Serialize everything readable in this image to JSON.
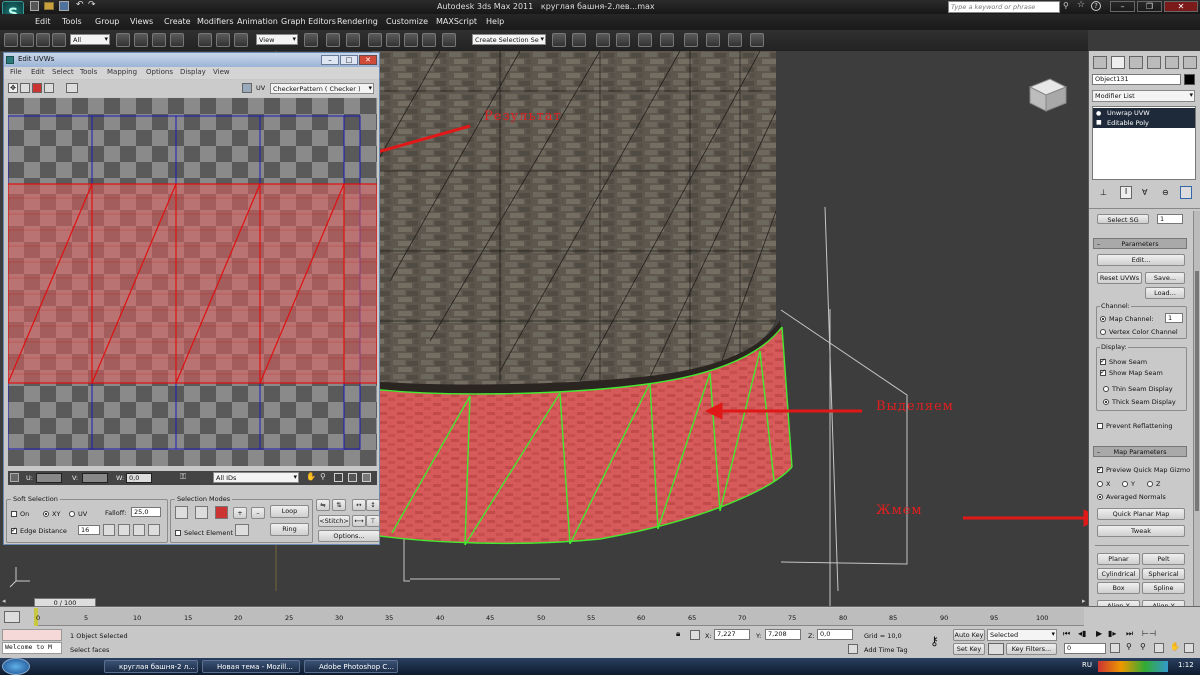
{
  "app": {
    "title": "Autodesk 3ds Max 2011",
    "file": "круглая башня-2.лев...max",
    "search_placeholder": "Type a keyword or phrase"
  },
  "menu": [
    "Edit",
    "Tools",
    "Group",
    "Views",
    "Create",
    "Modifiers",
    "Animation",
    "Graph Editors",
    "Rendering",
    "Customize",
    "MAXScript",
    "Help"
  ],
  "toolbar": {
    "selection_filter": "All",
    "ref_coord": "View",
    "named_selection": "Create Selection Se"
  },
  "uvw": {
    "title": "Edit UVWs",
    "menu": [
      "File",
      "Edit",
      "Select",
      "Tools",
      "Mapping",
      "Options",
      "Display",
      "View"
    ],
    "uv_label": "UV",
    "texture": "CheckerPattern  ( Checker )",
    "u_label": "U:",
    "v_label": "V:",
    "w_label": "W:",
    "w_value": "0,0",
    "ids": "All IDs",
    "soft_selection": "Soft Selection",
    "on_label": "On",
    "xy_label": "XY",
    "uv_axis_label": "UV",
    "falloff_label": "Falloff:",
    "falloff_value": "25,0",
    "edge_distance_label": "Edge Distance",
    "edge_distance_value": "16",
    "selection_modes": "Selection Modes",
    "select_element": "Select Element",
    "loop": "Loop",
    "ring": "Ring",
    "stitch": "Stitch",
    "options": "Options..."
  },
  "annotations": {
    "result": "Результат",
    "select": "Выделяем",
    "press": "Жмем"
  },
  "command_panel": {
    "object_name": "Object131",
    "modifier_list": "Modifier List",
    "stack": [
      "Unwrap UVW",
      "Editable Poly"
    ],
    "select_sg": "Select SG",
    "select_sg_value": "1",
    "parameters": "Parameters",
    "edit": "Edit...",
    "reset_uvws": "Reset UVWs",
    "save": "Save...",
    "load": "Load...",
    "channel": "Channel:",
    "map_channel": "Map Channel:",
    "map_channel_value": "1",
    "vertex_color_channel": "Vertex Color Channel",
    "display": "Display:",
    "show_seam": "Show Seam",
    "show_map_seam": "Show Map Seam",
    "thin_seam": "Thin Seam Display",
    "thick_seam": "Thick Seam Display",
    "prevent_reflattening": "Prevent Reflattening",
    "map_parameters": "Map Parameters",
    "preview_quick_map": "Preview Quick Map Gizmo",
    "x": "X",
    "y": "Y",
    "z": "Z",
    "averaged_normals": "Averaged Normals",
    "quick_planar_map": "Quick Planar Map",
    "tweak": "Tweak",
    "planar": "Planar",
    "pelt": "Pelt",
    "cylindrical": "Cylindrical",
    "spherical": "Spherical",
    "box": "Box",
    "spline": "Spline",
    "align_x": "Align X",
    "align_y": "Align Y"
  },
  "timeline": {
    "frame": "0 / 100",
    "ticks": [
      "0",
      "5",
      "10",
      "15",
      "20",
      "25",
      "30",
      "35",
      "40",
      "45",
      "50",
      "55",
      "60",
      "65",
      "70",
      "75",
      "80",
      "85",
      "90",
      "95",
      "100"
    ]
  },
  "status": {
    "welcome": "Welcome to M",
    "objects": "1 Object Selected",
    "prompt": "Select faces",
    "x_label": "X:",
    "x": "7,227",
    "y_label": "Y:",
    "y": "7,208",
    "z_label": "Z:",
    "z": "0,0",
    "grid": "Grid = 10,0",
    "add_time_tag": "Add Time Tag",
    "auto_key": "Auto Key",
    "set_key": "Set Key",
    "selected": "Selected",
    "key_filters": "Key Filters...",
    "frame_value": "0"
  },
  "taskbar": {
    "items": [
      "круглая башня-2 л...",
      "Новая тема - Mozill...",
      "Adobe Photoshop C..."
    ],
    "lang": "RU",
    "time": "1:12"
  }
}
